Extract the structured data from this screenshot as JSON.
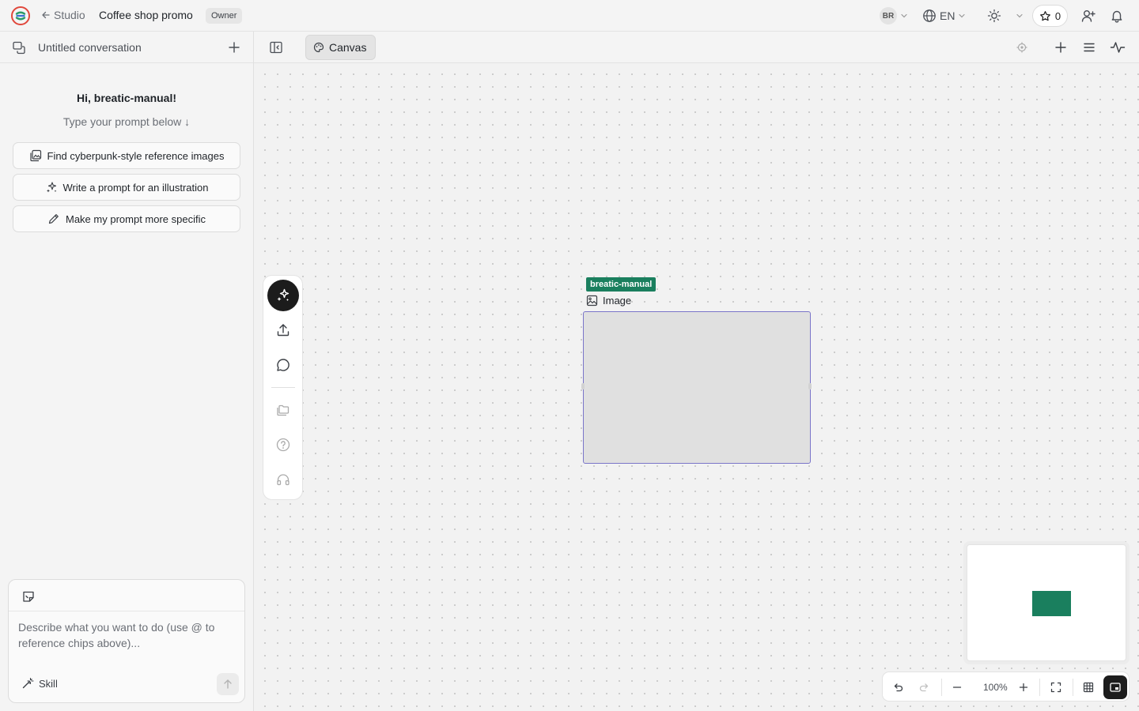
{
  "topbar": {
    "back_label": "Studio",
    "project_title": "Coffee shop promo",
    "role_badge": "Owner",
    "user_initials": "BR",
    "language": "EN",
    "star_count": "0"
  },
  "conversation": {
    "title": "Untitled conversation",
    "greeting": "Hi, breatic-manual!",
    "subgreeting": "Type your prompt below ↓",
    "suggestions": [
      {
        "label": "Find cyberpunk-style reference images",
        "icon": "image-search-icon"
      },
      {
        "label": "Write a prompt for an illustration",
        "icon": "sparkles-icon"
      },
      {
        "label": "Make my prompt more specific",
        "icon": "pencil-icon"
      }
    ],
    "composer": {
      "placeholder": "Describe what you want to do (use @ to reference chips above)...",
      "skill_label": "Skill"
    }
  },
  "canvas": {
    "tab_label": "Canvas",
    "node": {
      "owner_tag": "breatic-manual",
      "type_label": "Image"
    },
    "zoom": "100%"
  },
  "colors": {
    "accent_green": "#1a7f5e",
    "selection_purple": "#7a75c9",
    "dark": "#1c1c1c"
  }
}
